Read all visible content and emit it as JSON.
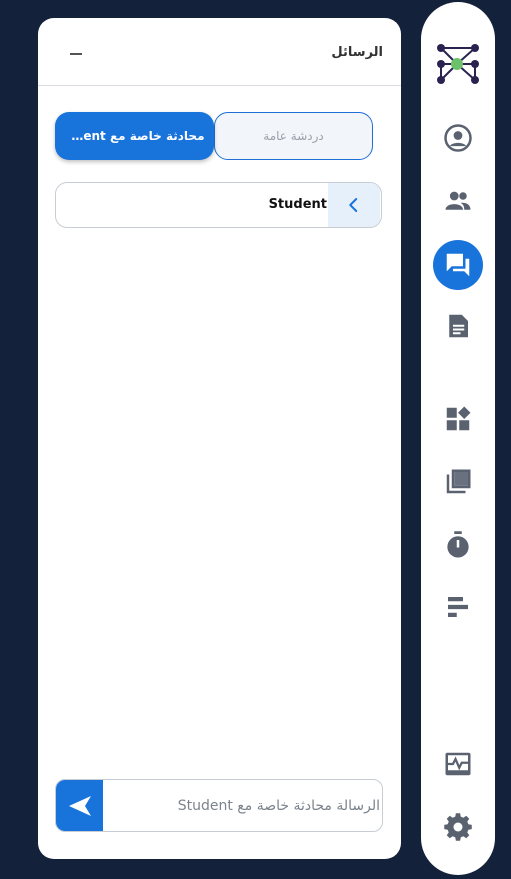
{
  "panel": {
    "title": "الرسائل",
    "tabs": {
      "general_label": "دردشة عامة",
      "private_label": "محادثة خاصة مع Student"
    },
    "recipient": {
      "name": "Student"
    },
    "composer": {
      "placeholder": "الرسالة محادثة خاصة مع Student",
      "value": ""
    }
  },
  "colors": {
    "accent": "#1873db",
    "background": "#14213a",
    "icon": "#5a6270"
  },
  "rail": {
    "items": [
      {
        "icon": "logo-icon"
      },
      {
        "icon": "user-circle-icon"
      },
      {
        "icon": "users-icon"
      },
      {
        "icon": "chat-icon",
        "active": true
      },
      {
        "icon": "document-icon"
      },
      {
        "icon": "widgets-icon"
      },
      {
        "icon": "library-icon"
      },
      {
        "icon": "timer-icon"
      },
      {
        "icon": "bar-chart-icon"
      },
      {
        "icon": "activity-monitor-icon"
      },
      {
        "icon": "gear-icon"
      }
    ]
  }
}
